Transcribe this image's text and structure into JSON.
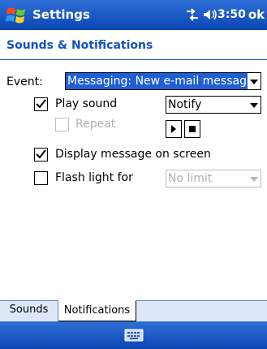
{
  "titlebar": {
    "title": "Settings",
    "time": "3:50",
    "ok_label": "ok",
    "icons": [
      "windows-start-flag-icon",
      "connectivity-icon",
      "volume-icon"
    ]
  },
  "header": {
    "title": "Sounds & Notifications"
  },
  "event": {
    "label": "Event:",
    "selected": "Messaging: New e-mail message"
  },
  "play_sound": {
    "label": "Play sound",
    "checked": true,
    "sound_selected": "Notify"
  },
  "repeat": {
    "label": "Repeat",
    "checked": false,
    "enabled": false
  },
  "playback": {
    "icons": [
      "play-icon",
      "stop-icon"
    ]
  },
  "display_message": {
    "label": "Display message on screen",
    "checked": true
  },
  "flash_light": {
    "label": "Flash light for",
    "checked": false,
    "duration_selected": "No limit",
    "enabled": false
  },
  "tabs": [
    {
      "label": "Sounds",
      "active": false
    },
    {
      "label": "Notifications",
      "active": true
    }
  ],
  "bottombar": {
    "icons": [
      "keyboard-icon"
    ]
  },
  "colors": {
    "bar_blue": "#0b47b3",
    "header_text_blue": "#1452c0",
    "selection_blue": "#1e5fd6",
    "tabstrip_bg": "#dde7f7",
    "disabled_gray": "#b0b0b0"
  }
}
